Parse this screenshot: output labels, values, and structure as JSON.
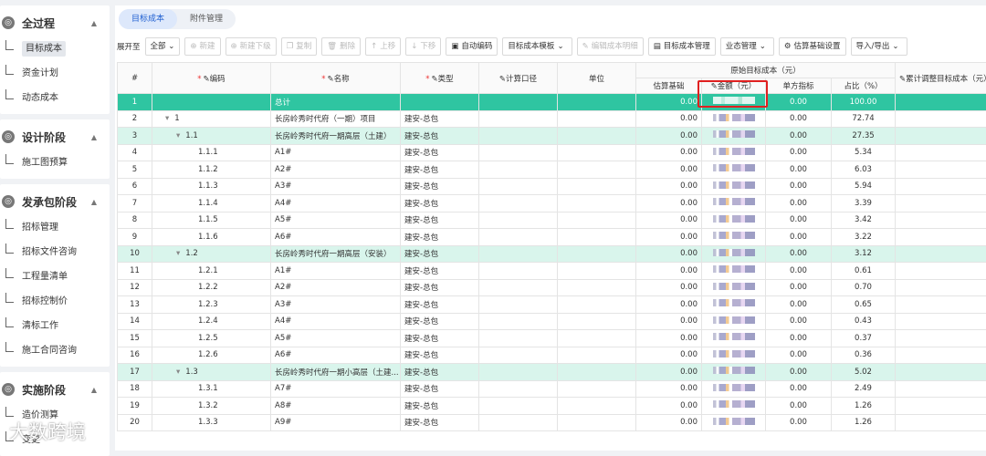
{
  "sidebar": {
    "sections": [
      {
        "title": "全过程",
        "icon": "stage-icon",
        "items": [
          "目标成本",
          "资金计划",
          "动态成本"
        ],
        "active": 0
      },
      {
        "title": "设计阶段",
        "icon": "design-icon",
        "items": [
          "施工图预算"
        ]
      },
      {
        "title": "发承包阶段",
        "icon": "contract-icon",
        "items": [
          "招标管理",
          "招标文件咨询",
          "工程量清单",
          "招标控制价",
          "清标工作",
          "施工合同咨询"
        ]
      },
      {
        "title": "实施阶段",
        "icon": "implement-icon",
        "items": [
          "造价测算",
          "变更"
        ]
      }
    ]
  },
  "tabs": [
    {
      "label": "目标成本",
      "active": true
    },
    {
      "label": "附件管理",
      "active": false
    }
  ],
  "toolbar": {
    "expand_label": "展开至",
    "expand_value": "全部",
    "buttons": [
      {
        "label": "新建",
        "icon": "plus-icon",
        "disabled": true
      },
      {
        "label": "新建下级",
        "icon": "plus-child-icon",
        "disabled": true
      },
      {
        "label": "复制",
        "icon": "copy-icon",
        "disabled": true
      },
      {
        "label": "删除",
        "icon": "trash-icon",
        "disabled": true
      },
      {
        "label": "上移",
        "icon": "arrow-up-icon",
        "disabled": true
      },
      {
        "label": "下移",
        "icon": "arrow-down-icon",
        "disabled": true
      },
      {
        "label": "自动编码",
        "icon": "code-icon",
        "disabled": false
      },
      {
        "label": "目标成本模板",
        "icon": "chevron-down-icon",
        "disabled": false
      },
      {
        "label": "编辑成本明细",
        "icon": "edit-icon",
        "disabled": true
      },
      {
        "label": "目标成本管理",
        "icon": "doc-icon",
        "disabled": false
      },
      {
        "label": "业态管理",
        "icon": "chevron-down-icon",
        "disabled": false
      },
      {
        "label": "估算基础设置",
        "icon": "gear-icon",
        "disabled": false
      },
      {
        "label": "导入/导出",
        "icon": "chevron-down-icon",
        "disabled": false
      }
    ]
  },
  "table": {
    "group_header": "原始目标成本（元）",
    "headers": {
      "index": "#",
      "code": "编码",
      "name": "名称",
      "type": "类型",
      "calc": "计算口径",
      "unit": "单位",
      "est_base": "估算基础",
      "amount": "金额（元）",
      "unit_index": "单方指标",
      "ratio": "占比（%）",
      "cumulative": "累计调整目标成本（元）"
    },
    "rows": [
      {
        "n": "1",
        "code": "",
        "name": "总计",
        "type": "",
        "base": "0.00",
        "unit_idx": "0.00",
        "ratio": "100.00",
        "kind": "total",
        "caret": false,
        "lvl": 0
      },
      {
        "n": "2",
        "code": "1",
        "name": "长房岭秀时代府（一期）项目",
        "type": "建安-总包",
        "base": "0.00",
        "unit_idx": "0.00",
        "ratio": "72.74",
        "kind": "normal",
        "caret": true,
        "lvl": 1
      },
      {
        "n": "3",
        "code": "1.1",
        "name": "长房岭秀时代府一期高层（土建）",
        "type": "建安-总包",
        "base": "0.00",
        "unit_idx": "0.00",
        "ratio": "27.35",
        "kind": "group",
        "caret": true,
        "lvl": 2
      },
      {
        "n": "4",
        "code": "1.1.1",
        "name": "A1#",
        "type": "建安-总包",
        "base": "0.00",
        "unit_idx": "0.00",
        "ratio": "5.34",
        "kind": "normal",
        "caret": false,
        "lvl": 3
      },
      {
        "n": "5",
        "code": "1.1.2",
        "name": "A2#",
        "type": "建安-总包",
        "base": "0.00",
        "unit_idx": "0.00",
        "ratio": "6.03",
        "kind": "normal",
        "caret": false,
        "lvl": 3
      },
      {
        "n": "6",
        "code": "1.1.3",
        "name": "A3#",
        "type": "建安-总包",
        "base": "0.00",
        "unit_idx": "0.00",
        "ratio": "5.94",
        "kind": "normal",
        "caret": false,
        "lvl": 3
      },
      {
        "n": "7",
        "code": "1.1.4",
        "name": "A4#",
        "type": "建安-总包",
        "base": "0.00",
        "unit_idx": "0.00",
        "ratio": "3.39",
        "kind": "normal",
        "caret": false,
        "lvl": 3
      },
      {
        "n": "8",
        "code": "1.1.5",
        "name": "A5#",
        "type": "建安-总包",
        "base": "0.00",
        "unit_idx": "0.00",
        "ratio": "3.42",
        "kind": "normal",
        "caret": false,
        "lvl": 3
      },
      {
        "n": "9",
        "code": "1.1.6",
        "name": "A6#",
        "type": "建安-总包",
        "base": "0.00",
        "unit_idx": "0.00",
        "ratio": "3.22",
        "kind": "normal",
        "caret": false,
        "lvl": 3
      },
      {
        "n": "10",
        "code": "1.2",
        "name": "长房岭秀时代府一期高层（安装）",
        "type": "建安-总包",
        "base": "0.00",
        "unit_idx": "0.00",
        "ratio": "3.12",
        "kind": "group",
        "caret": true,
        "lvl": 2
      },
      {
        "n": "11",
        "code": "1.2.1",
        "name": "A1#",
        "type": "建安-总包",
        "base": "0.00",
        "unit_idx": "0.00",
        "ratio": "0.61",
        "kind": "normal",
        "caret": false,
        "lvl": 3
      },
      {
        "n": "12",
        "code": "1.2.2",
        "name": "A2#",
        "type": "建安-总包",
        "base": "0.00",
        "unit_idx": "0.00",
        "ratio": "0.70",
        "kind": "normal",
        "caret": false,
        "lvl": 3
      },
      {
        "n": "13",
        "code": "1.2.3",
        "name": "A3#",
        "type": "建安-总包",
        "base": "0.00",
        "unit_idx": "0.00",
        "ratio": "0.65",
        "kind": "normal",
        "caret": false,
        "lvl": 3
      },
      {
        "n": "14",
        "code": "1.2.4",
        "name": "A4#",
        "type": "建安-总包",
        "base": "0.00",
        "unit_idx": "0.00",
        "ratio": "0.43",
        "kind": "normal",
        "caret": false,
        "lvl": 3
      },
      {
        "n": "15",
        "code": "1.2.5",
        "name": "A5#",
        "type": "建安-总包",
        "base": "0.00",
        "unit_idx": "0.00",
        "ratio": "0.37",
        "kind": "normal",
        "caret": false,
        "lvl": 3
      },
      {
        "n": "16",
        "code": "1.2.6",
        "name": "A6#",
        "type": "建安-总包",
        "base": "0.00",
        "unit_idx": "0.00",
        "ratio": "0.36",
        "kind": "normal",
        "caret": false,
        "lvl": 3
      },
      {
        "n": "17",
        "code": "1.3",
        "name": "长房岭秀时代府一期小高层（土建...",
        "type": "建安-总包",
        "base": "0.00",
        "unit_idx": "0.00",
        "ratio": "5.02",
        "kind": "group",
        "caret": true,
        "lvl": 2
      },
      {
        "n": "18",
        "code": "1.3.1",
        "name": "A7#",
        "type": "建安-总包",
        "base": "0.00",
        "unit_idx": "0.00",
        "ratio": "2.49",
        "kind": "normal",
        "caret": false,
        "lvl": 3
      },
      {
        "n": "19",
        "code": "1.3.2",
        "name": "A8#",
        "type": "建安-总包",
        "base": "0.00",
        "unit_idx": "0.00",
        "ratio": "1.26",
        "kind": "normal",
        "caret": false,
        "lvl": 3
      },
      {
        "n": "20",
        "code": "1.3.3",
        "name": "A9#",
        "type": "建安-总包",
        "base": "0.00",
        "unit_idx": "0.00",
        "ratio": "1.26",
        "kind": "normal",
        "caret": false,
        "lvl": 3
      }
    ]
  },
  "watermark": "大数跨境",
  "colors": {
    "total_row": "#2fc5a1",
    "group_row": "#d9f5ec",
    "highlight": "#e02020",
    "accent": "#1f5fd1"
  }
}
